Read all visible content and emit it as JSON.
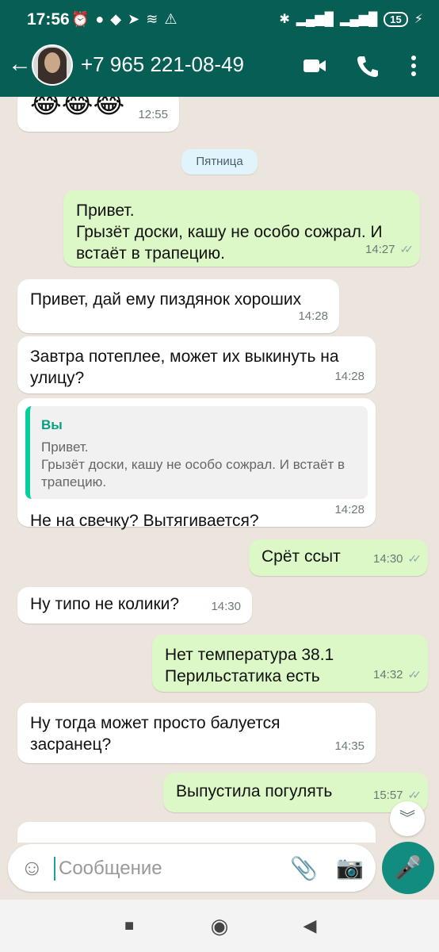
{
  "status_bar": {
    "time": "17:56",
    "battery": "15"
  },
  "header": {
    "contact": "+7 965 221-08-49"
  },
  "chat": {
    "date_divider": "Пятница",
    "messages": [
      {
        "dir": "in",
        "text": "😂😂😂",
        "time": "12:55"
      },
      {
        "dir": "out",
        "text": "Привет.\nГрызёт доски, кашу не особо сожрал. И встаёт в трапецию.",
        "time": "14:27"
      },
      {
        "dir": "in",
        "text": "Привет, дай ему пиздянок хороших",
        "time": "14:28"
      },
      {
        "dir": "in",
        "text": "Завтра потеплее, может их выкинуть на улицу?",
        "time": "14:28"
      },
      {
        "dir": "in",
        "quote_author": "Вы",
        "quote_text": "Привет.\nГрызёт доски, кашу не особо сожрал. И встаёт в трапецию.",
        "text": "Не на свечку? Вытягивается?",
        "time": "14:28"
      },
      {
        "dir": "out",
        "text": "Срёт ссыт",
        "time": "14:30"
      },
      {
        "dir": "in",
        "text": "Ну типо не колики?",
        "time": "14:30"
      },
      {
        "dir": "out",
        "text": "Нет температура 38.1\nПерильстатика есть",
        "time": "14:32"
      },
      {
        "dir": "in",
        "text": "Ну тогда может просто балуется засранец?",
        "time": "14:35"
      },
      {
        "dir": "out",
        "text": "Выпустила погулять",
        "time": "15:57"
      }
    ]
  },
  "input": {
    "placeholder": "Сообщение"
  },
  "icons": [
    "back-arrow-icon",
    "video-call-icon",
    "phone-icon",
    "more-vert-icon",
    "emoji-icon",
    "paperclip-icon",
    "camera-icon",
    "mic-icon",
    "scroll-down-icon"
  ],
  "colors": {
    "header": "#075E54",
    "outgoing_bubble": "#DCF8C6",
    "incoming_bubble": "#FFFFFF",
    "background": "#ECE5DD",
    "accent": "#128C7E"
  }
}
